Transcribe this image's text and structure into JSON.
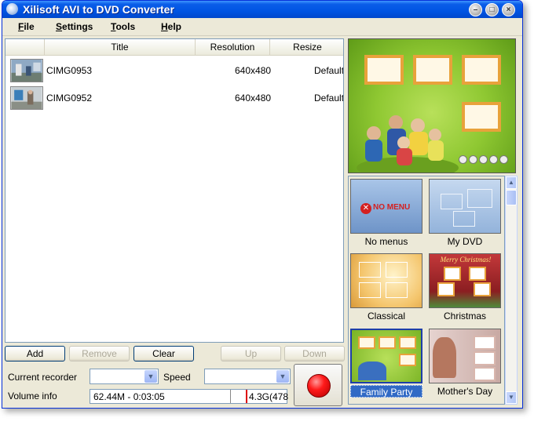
{
  "window": {
    "title": "Xilisoft AVI to DVD Converter"
  },
  "menu": [
    "File",
    "Settings",
    "Tools",
    "Help"
  ],
  "list": {
    "columns": [
      "Title",
      "Resolution",
      "Resize"
    ],
    "rows": [
      {
        "title": "CIMG0953",
        "resolution": "640x480",
        "resize": "Default"
      },
      {
        "title": "CIMG0952",
        "resolution": "640x480",
        "resize": "Default"
      }
    ]
  },
  "buttons": {
    "add": "Add",
    "remove": "Remove",
    "clear": "Clear",
    "up": "Up",
    "down": "Down"
  },
  "recorder": {
    "label": "Current recorder",
    "value": ""
  },
  "speed": {
    "label": "Speed",
    "value": ""
  },
  "volume": {
    "label": "Volume info",
    "used": "62.44M - 0:03:05",
    "capacity": "4.3G(478"
  },
  "templates": [
    {
      "name": "No menus",
      "badge": "NO MENU"
    },
    {
      "name": "My DVD"
    },
    {
      "name": "Classical"
    },
    {
      "name": "Christmas",
      "badge": "Merry Christmas!"
    },
    {
      "name": "Family Party",
      "selected": true
    },
    {
      "name": "Mother's Day"
    }
  ],
  "colors": {
    "titlebar": "#0054e3",
    "selection": "#316ac5",
    "record": "#ff1a1a"
  }
}
